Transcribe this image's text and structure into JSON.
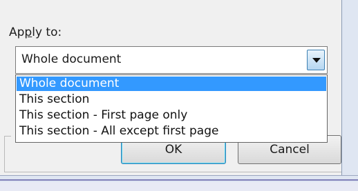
{
  "apply_to": {
    "label": "Apply to:",
    "label_prefix": "Ap",
    "label_underline": "p",
    "label_suffix": "ly to:",
    "selected_value": "Whole document",
    "options": [
      "Whole document",
      "This section",
      "This section - First page only",
      "This section - All except first page"
    ],
    "highlighted_index": 0
  },
  "buttons": {
    "ok": "OK",
    "cancel": "Cancel"
  },
  "colors": {
    "highlight": "#3399ff",
    "dialog_bg": "#f0f0f0"
  },
  "icons": {
    "dropdown": "chevron-down-icon"
  }
}
